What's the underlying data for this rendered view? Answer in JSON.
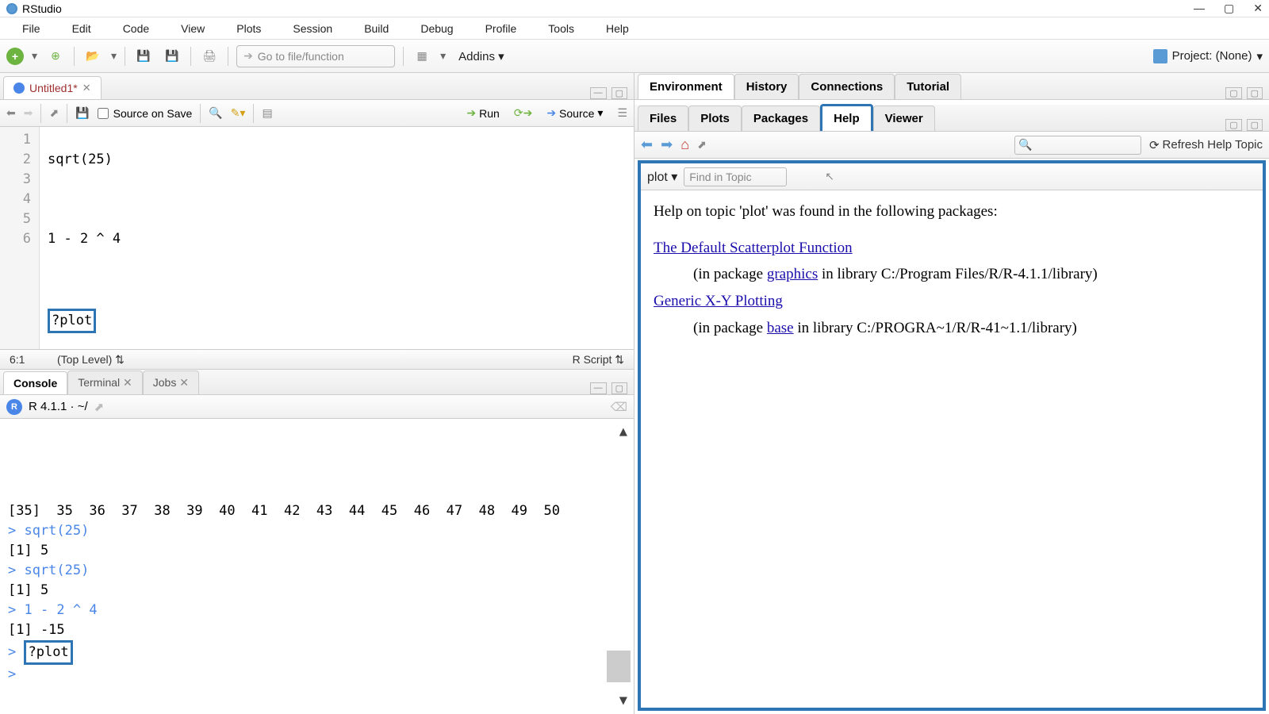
{
  "title": "RStudio",
  "menu": [
    "File",
    "Edit",
    "Code",
    "View",
    "Plots",
    "Session",
    "Build",
    "Debug",
    "Profile",
    "Tools",
    "Help"
  ],
  "toolbar": {
    "goto_placeholder": "Go to file/function",
    "addins": "Addins",
    "project": "Project: (None)"
  },
  "source": {
    "tab": "Untitled1*",
    "source_on_save": "Source on Save",
    "run": "Run",
    "source_btn": "Source",
    "lines": [
      "1",
      "2",
      "3",
      "4",
      "5",
      "6"
    ],
    "code1": "sqrt(25)",
    "code3": "1 - 2 ^ 4",
    "code5": "?plot",
    "cursor": "6:1",
    "scope": "(Top Level)",
    "lang": "R Script"
  },
  "console": {
    "tabs": [
      "Console",
      "Terminal",
      "Jobs"
    ],
    "version": "R 4.1.1 · ~/",
    "lines": [
      "[35]  35  36  37  38  39  40  41  42  43  44  45  46  47  48  49  50",
      "> sqrt(25)",
      "[1] 5",
      "> sqrt(25)",
      "[1] 5",
      "> 1 - 2 ^ 4",
      "[1] -15",
      "> ?plot",
      "> "
    ],
    "highlight": "?plot"
  },
  "env_tabs": [
    "Environment",
    "History",
    "Connections",
    "Tutorial"
  ],
  "view_tabs": [
    "Files",
    "Plots",
    "Packages",
    "Help",
    "Viewer"
  ],
  "help": {
    "search_placeholder": "",
    "refresh": "Refresh Help Topic",
    "topic": "plot",
    "find_placeholder": "Find in Topic",
    "intro": "Help on topic 'plot' was found in the following packages:",
    "link1": "The Default Scatterplot Function",
    "pkg1_a": "(in package ",
    "pkg1_link": "graphics",
    "pkg1_b": " in library C:/Program Files/R/R-4.1.1/library)",
    "link2": "Generic X-Y Plotting",
    "pkg2_a": "(in package ",
    "pkg2_link": "base",
    "pkg2_b": " in library C:/PROGRA~1/R/R-41~1.1/library)"
  }
}
